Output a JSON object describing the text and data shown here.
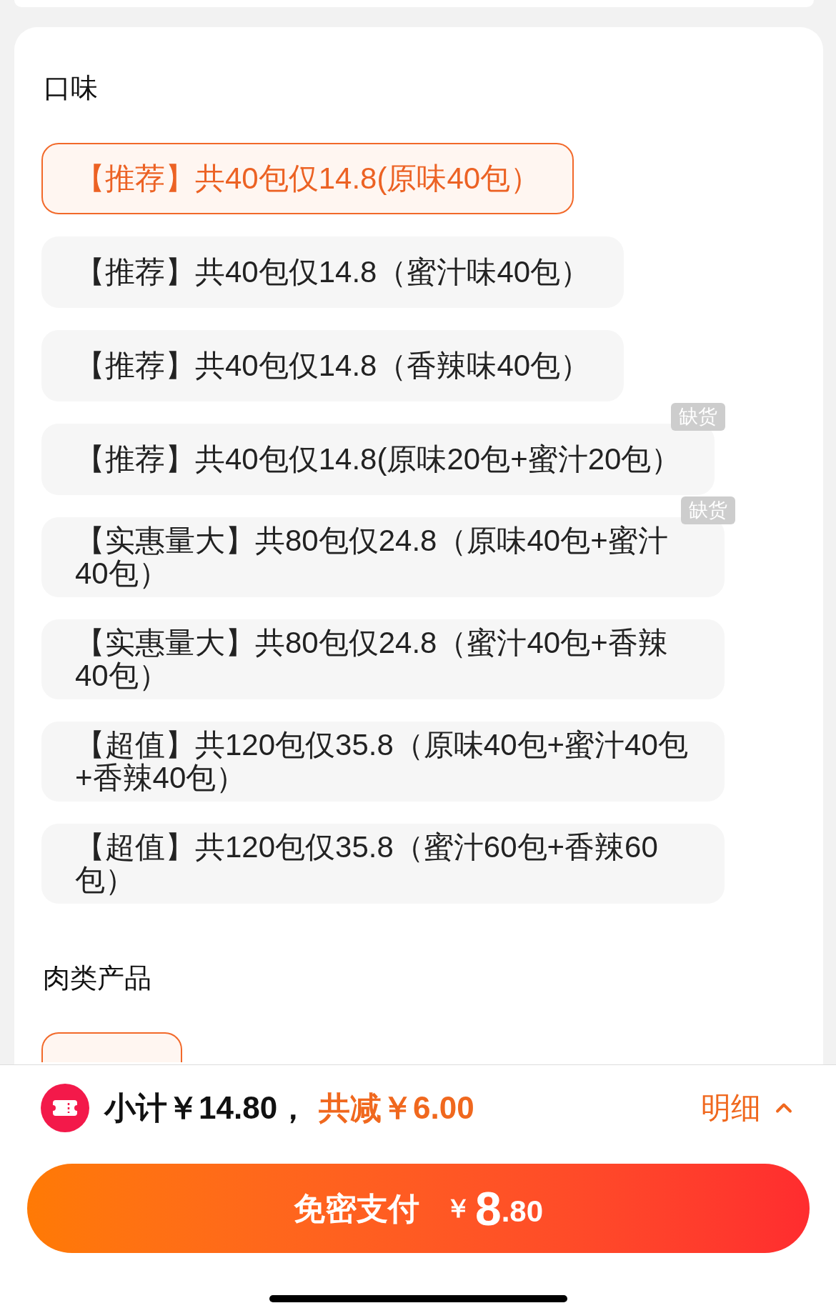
{
  "flavor_section": {
    "title": "口味",
    "options": [
      {
        "label": "【推荐】共40包仅14.8(原味40包）",
        "selected": true
      },
      {
        "label": "【推荐】共40包仅14.8（蜜汁味40包）",
        "selected": false
      },
      {
        "label": "【推荐】共40包仅14.8（香辣味40包）",
        "selected": false
      },
      {
        "label": "【推荐】共40包仅14.8(原味20包+蜜汁20包）",
        "selected": false,
        "badge": "缺货"
      },
      {
        "label": "【实惠量大】共80包仅24.8（原味40包+蜜汁40包）",
        "selected": false,
        "badge": "缺货"
      },
      {
        "label": "【实惠量大】共80包仅24.8（蜜汁40包+香辣40包）",
        "selected": false
      },
      {
        "label": "【超值】共120包仅35.8（原味40包+蜜汁40包+香辣40包）",
        "selected": false
      },
      {
        "label": "【超值】共120包仅35.8（蜜汁60包+香辣60包）",
        "selected": false
      }
    ]
  },
  "meat_section": {
    "title": "肉类产品",
    "options": [
      {
        "selected": true
      }
    ]
  },
  "bottom_bar": {
    "subtotal": "小计￥14.80，",
    "discount": "共减￥6.00",
    "details_link": "明细",
    "pay_button": {
      "label": "免密支付",
      "currency": "￥",
      "amount_integer": "8",
      "amount_decimal": ".80"
    }
  }
}
